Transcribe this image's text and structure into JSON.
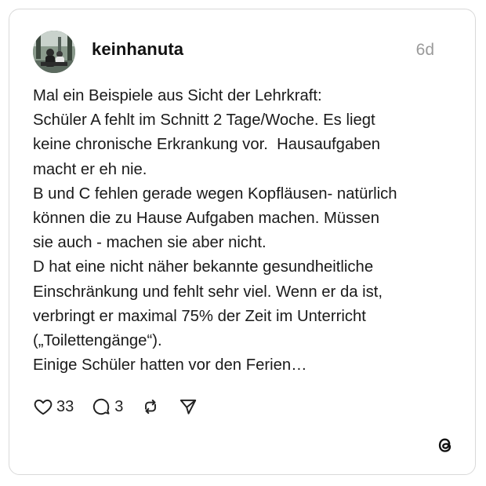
{
  "post": {
    "username": "keinhanuta",
    "timestamp": "6d",
    "lines": [
      "Mal ein Beispiele aus Sicht der Lehrkraft:",
      "Schüler A fehlt im Schnitt 2 Tage/Woche. Es liegt",
      "keine chronische Erkrankung vor.  Hausaufgaben",
      "macht er eh nie.",
      "B und C fehlen gerade wegen Kopfläusen- natürlich",
      "können die zu Hause Aufgaben machen. Müssen",
      "sie auch - machen sie aber nicht.",
      "D hat eine nicht näher bekannte gesundheitliche",
      "Einschränkung und fehlt sehr viel. Wenn er da ist,",
      "verbringt er maximal 75% der Zeit im Unterricht",
      "(„Toilettengänge“).",
      "Einige Schüler hatten vor den Ferien…"
    ]
  },
  "actions": {
    "like_count": "33",
    "reply_count": "3"
  },
  "icons": {
    "like": "heart-icon",
    "reply": "reply-icon",
    "repost": "repost-icon",
    "share": "send-icon",
    "brand": "threads-logo-icon"
  }
}
